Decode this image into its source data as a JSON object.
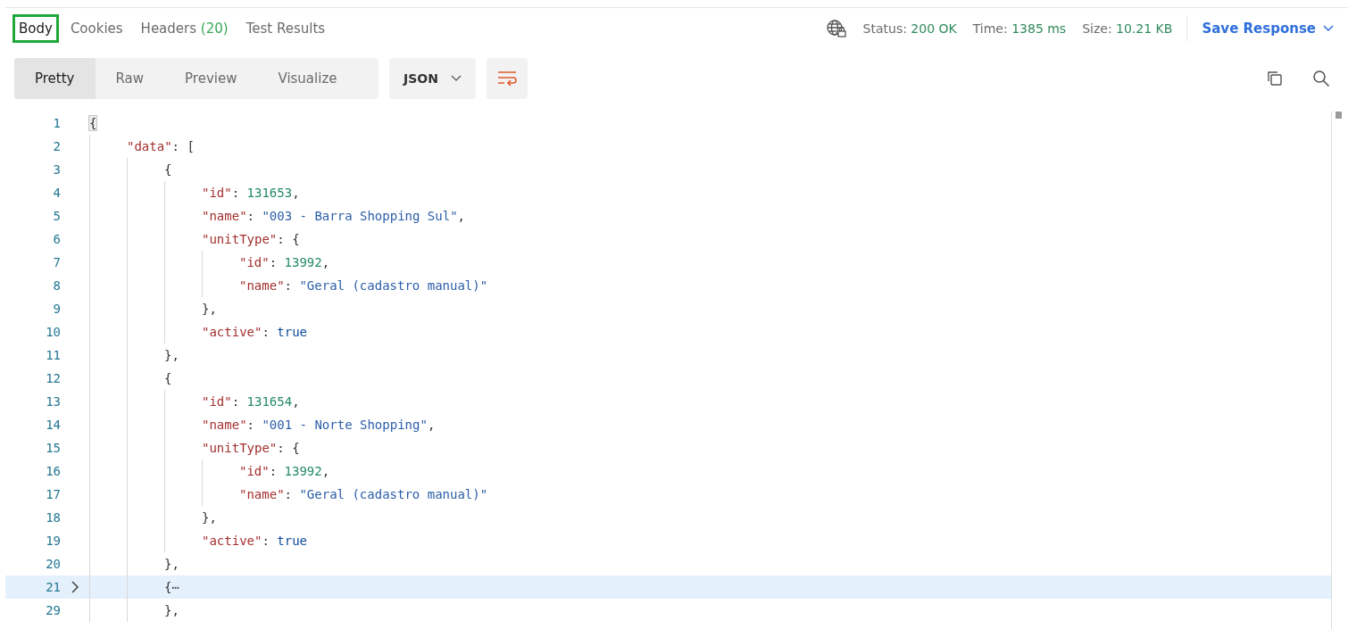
{
  "response_tabs": [
    {
      "label": "Body",
      "selected": true
    },
    {
      "label": "Cookies",
      "selected": false
    },
    {
      "label": "Headers",
      "count": "(20)",
      "selected": false
    },
    {
      "label": "Test Results",
      "selected": false
    }
  ],
  "status": {
    "items": [
      {
        "label": "Status:",
        "value": "200 OK"
      },
      {
        "label": "Time:",
        "value": "1385 ms"
      },
      {
        "label": "Size:",
        "value": "10.21 KB"
      }
    ],
    "save_button": "Save Response"
  },
  "view_modes": [
    {
      "label": "Pretty",
      "selected": true
    },
    {
      "label": "Raw",
      "selected": false
    },
    {
      "label": "Preview",
      "selected": false
    },
    {
      "label": "Visualize",
      "selected": false
    }
  ],
  "format_dropdown": {
    "value": "JSON"
  },
  "editor": {
    "lines": [
      {
        "number": "1",
        "highlighted": false,
        "collapsed": false,
        "bracket_match": true,
        "tokens": [
          {
            "kind": "punct",
            "text": "{"
          }
        ],
        "children": [
          {
            "number": "2",
            "highlighted": false,
            "collapsed": false,
            "bracket_match": false,
            "tokens": [
              {
                "kind": "key",
                "text": "\"data\""
              },
              {
                "kind": "punct",
                "text": ": ["
              }
            ],
            "children": [
              {
                "number": "3",
                "highlighted": false,
                "collapsed": false,
                "bracket_match": false,
                "tokens": [
                  {
                    "kind": "punct",
                    "text": "{"
                  }
                ],
                "children": [
                  {
                    "number": "4",
                    "highlighted": false,
                    "collapsed": false,
                    "bracket_match": false,
                    "tokens": [
                      {
                        "kind": "key",
                        "text": "\"id\""
                      },
                      {
                        "kind": "punct",
                        "text": ": "
                      },
                      {
                        "kind": "number",
                        "text": "131653"
                      },
                      {
                        "kind": "punct",
                        "text": ","
                      }
                    ]
                  },
                  {
                    "number": "5",
                    "highlighted": false,
                    "collapsed": false,
                    "bracket_match": false,
                    "tokens": [
                      {
                        "kind": "key",
                        "text": "\"name\""
                      },
                      {
                        "kind": "punct",
                        "text": ": "
                      },
                      {
                        "kind": "string",
                        "text": "\"003 - Barra Shopping Sul\""
                      },
                      {
                        "kind": "punct",
                        "text": ","
                      }
                    ]
                  },
                  {
                    "number": "6",
                    "highlighted": false,
                    "collapsed": false,
                    "bracket_match": false,
                    "tokens": [
                      {
                        "kind": "key",
                        "text": "\"unitType\""
                      },
                      {
                        "kind": "punct",
                        "text": ": {"
                      }
                    ],
                    "children": [
                      {
                        "number": "7",
                        "highlighted": false,
                        "collapsed": false,
                        "bracket_match": false,
                        "tokens": [
                          {
                            "kind": "key",
                            "text": "\"id\""
                          },
                          {
                            "kind": "punct",
                            "text": ": "
                          },
                          {
                            "kind": "number",
                            "text": "13992"
                          },
                          {
                            "kind": "punct",
                            "text": ","
                          }
                        ]
                      },
                      {
                        "number": "8",
                        "highlighted": false,
                        "collapsed": false,
                        "bracket_match": false,
                        "tokens": [
                          {
                            "kind": "key",
                            "text": "\"name\""
                          },
                          {
                            "kind": "punct",
                            "text": ": "
                          },
                          {
                            "kind": "string",
                            "text": "\"Geral (cadastro manual)\""
                          }
                        ]
                      }
                    ]
                  },
                  {
                    "number": "9",
                    "highlighted": false,
                    "collapsed": false,
                    "bracket_match": false,
                    "tokens": [
                      {
                        "kind": "punct",
                        "text": "},"
                      }
                    ]
                  },
                  {
                    "number": "10",
                    "highlighted": false,
                    "collapsed": false,
                    "bracket_match": false,
                    "tokens": [
                      {
                        "kind": "key",
                        "text": "\"active\""
                      },
                      {
                        "kind": "punct",
                        "text": ": "
                      },
                      {
                        "kind": "bool",
                        "text": "true"
                      }
                    ]
                  }
                ]
              },
              {
                "number": "11",
                "highlighted": false,
                "collapsed": false,
                "bracket_match": false,
                "tokens": [
                  {
                    "kind": "punct",
                    "text": "},"
                  }
                ]
              },
              {
                "number": "12",
                "highlighted": false,
                "collapsed": false,
                "bracket_match": false,
                "tokens": [
                  {
                    "kind": "punct",
                    "text": "{"
                  }
                ],
                "children": [
                  {
                    "number": "13",
                    "highlighted": false,
                    "collapsed": false,
                    "bracket_match": false,
                    "tokens": [
                      {
                        "kind": "key",
                        "text": "\"id\""
                      },
                      {
                        "kind": "punct",
                        "text": ": "
                      },
                      {
                        "kind": "number",
                        "text": "131654"
                      },
                      {
                        "kind": "punct",
                        "text": ","
                      }
                    ]
                  },
                  {
                    "number": "14",
                    "highlighted": false,
                    "collapsed": false,
                    "bracket_match": false,
                    "tokens": [
                      {
                        "kind": "key",
                        "text": "\"name\""
                      },
                      {
                        "kind": "punct",
                        "text": ": "
                      },
                      {
                        "kind": "string",
                        "text": "\"001 - Norte Shopping\""
                      },
                      {
                        "kind": "punct",
                        "text": ","
                      }
                    ]
                  },
                  {
                    "number": "15",
                    "highlighted": false,
                    "collapsed": false,
                    "bracket_match": false,
                    "tokens": [
                      {
                        "kind": "key",
                        "text": "\"unitType\""
                      },
                      {
                        "kind": "punct",
                        "text": ": {"
                      }
                    ],
                    "children": [
                      {
                        "number": "16",
                        "highlighted": false,
                        "collapsed": false,
                        "bracket_match": false,
                        "tokens": [
                          {
                            "kind": "key",
                            "text": "\"id\""
                          },
                          {
                            "kind": "punct",
                            "text": ": "
                          },
                          {
                            "kind": "number",
                            "text": "13992"
                          },
                          {
                            "kind": "punct",
                            "text": ","
                          }
                        ]
                      },
                      {
                        "number": "17",
                        "highlighted": false,
                        "collapsed": false,
                        "bracket_match": false,
                        "tokens": [
                          {
                            "kind": "key",
                            "text": "\"name\""
                          },
                          {
                            "kind": "punct",
                            "text": ": "
                          },
                          {
                            "kind": "string",
                            "text": "\"Geral (cadastro manual)\""
                          }
                        ]
                      }
                    ]
                  },
                  {
                    "number": "18",
                    "highlighted": false,
                    "collapsed": false,
                    "bracket_match": false,
                    "tokens": [
                      {
                        "kind": "punct",
                        "text": "},"
                      }
                    ]
                  },
                  {
                    "number": "19",
                    "highlighted": false,
                    "collapsed": false,
                    "bracket_match": false,
                    "tokens": [
                      {
                        "kind": "key",
                        "text": "\"active\""
                      },
                      {
                        "kind": "punct",
                        "text": ": "
                      },
                      {
                        "kind": "bool",
                        "text": "true"
                      }
                    ]
                  }
                ]
              },
              {
                "number": "20",
                "highlighted": false,
                "collapsed": false,
                "bracket_match": false,
                "tokens": [
                  {
                    "kind": "punct",
                    "text": "},"
                  }
                ]
              },
              {
                "number": "21",
                "highlighted": true,
                "collapsed": true,
                "bracket_match": false,
                "tokens": [
                  {
                    "kind": "punct",
                    "text": "{"
                  },
                  {
                    "kind": "fold",
                    "text": "⋯"
                  }
                ]
              },
              {
                "number": "29",
                "highlighted": false,
                "collapsed": false,
                "bracket_match": false,
                "tokens": [
                  {
                    "kind": "punct",
                    "text": "},"
                  }
                ]
              }
            ]
          }
        ]
      }
    ]
  }
}
